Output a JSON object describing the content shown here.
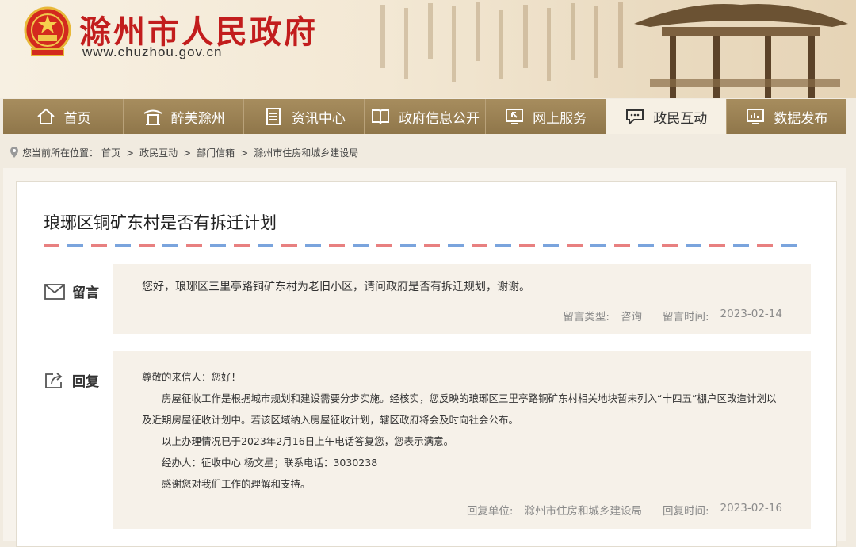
{
  "header": {
    "site_title": "滁州市人民政府",
    "site_url": "www.chuzhou.gov.cn"
  },
  "nav": {
    "items": [
      {
        "label": "首页",
        "icon": "home-icon"
      },
      {
        "label": "醉美滁州",
        "icon": "pavilion-icon"
      },
      {
        "label": "资讯中心",
        "icon": "document-icon"
      },
      {
        "label": "政府信息公开",
        "icon": "book-icon"
      },
      {
        "label": "网上服务",
        "icon": "monitor-cursor-icon"
      },
      {
        "label": "政民互动",
        "icon": "chat-bubble-icon",
        "active": true
      },
      {
        "label": "数据发布",
        "icon": "chart-monitor-icon"
      }
    ]
  },
  "breadcrumb": {
    "prefix": "您当前所在位置：",
    "items": [
      "首页",
      "政民互动",
      "部门信箱",
      "滁州市住房和城乡建设局"
    ],
    "separator": ">"
  },
  "letter": {
    "title": "琅琊区铜矿东村是否有拆迁计划",
    "message": {
      "label": "留言",
      "text": "您好，琅琊区三里亭路铜矿东村为老旧小区，请问政府是否有拆迁规划，谢谢。",
      "type_label": "留言类型:",
      "type_value": "咨询",
      "time_label": "留言时间:",
      "time_value": "2023-02-14"
    },
    "reply": {
      "label": "回复",
      "greeting": "尊敬的来信人：您好！",
      "paragraphs": [
        "房屋征收工作是根据城市规划和建设需要分步实施。经核实，您反映的琅琊区三里亭路铜矿东村相关地块暂未列入“十四五”棚户区改造计划以及近期房屋征收计划中。若该区域纳入房屋征收计划，辖区政府将会及时向社会公布。",
        "以上办理情况已于2023年2月16日上午电话答复您，您表示满意。",
        "经办人：征收中心  杨文星；联系电话：3030238",
        "感谢您对我们工作的理解和支持。"
      ],
      "unit_label": "回复单位:",
      "unit_value": "滁州市住房和城乡建设局",
      "time_label": "回复时间:",
      "time_value": "2023-02-16"
    }
  },
  "colors": {
    "brand_red": "#c21d1d",
    "nav_gold": "#9a8054",
    "background": "#f1ebe0"
  }
}
